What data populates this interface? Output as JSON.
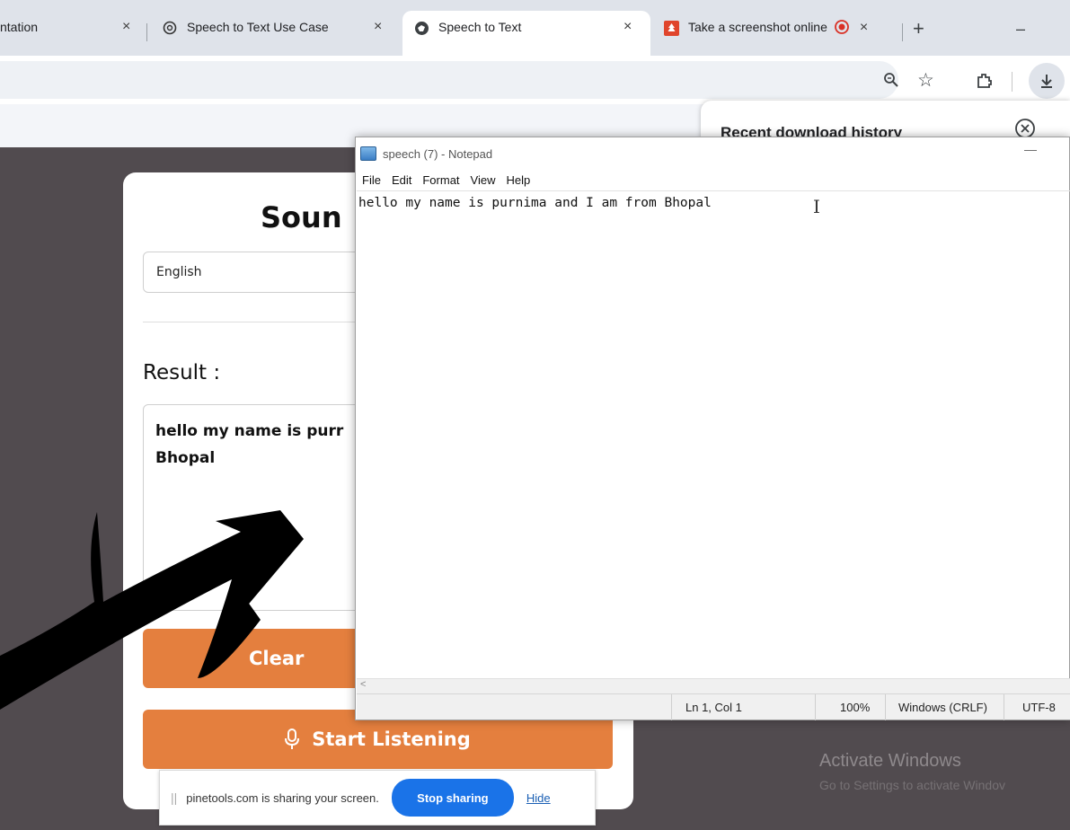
{
  "tabs": [
    {
      "label": "ntation",
      "close": "×"
    },
    {
      "label": "Speech to Text Use Case",
      "close": "×",
      "icon": "openai-icon"
    },
    {
      "label": "Speech to Text",
      "close": "×",
      "icon": "globe-icon",
      "active": true
    },
    {
      "label": "Take a screenshot online",
      "close": "×",
      "icon": "pinetools-icon",
      "recording": true
    }
  ],
  "new_tab": "+",
  "window_minimize": "–",
  "downloads_panel": {
    "title": "Recent download history"
  },
  "page": {
    "title": "Soun",
    "language_select": "English",
    "result_label": "Result :",
    "result_text": "hello my name is purr",
    "result_text_2": "Bhopal",
    "clear_button": "Clear",
    "start_button": "Start Listening"
  },
  "share_bar": {
    "message": "pinetools.com is sharing your screen.",
    "stop_button": "Stop sharing",
    "hide_link": "Hide"
  },
  "notepad": {
    "title": "speech (7) - Notepad",
    "menu": [
      "File",
      "Edit",
      "Format",
      "View",
      "Help"
    ],
    "content": "hello my name is purnima and I am from Bhopal",
    "scroll_left": "<",
    "status": {
      "position": "Ln 1, Col 1",
      "zoom": "100%",
      "line_ending": "Windows (CRLF)",
      "encoding": "UTF-8"
    }
  },
  "watermark": {
    "line1": "Activate Windows",
    "line2": "Go to Settings to activate Windov"
  },
  "colors": {
    "accent_orange": "#e47f3e",
    "page_bg": "#514b4f",
    "stop_blue": "#1a73e8"
  }
}
